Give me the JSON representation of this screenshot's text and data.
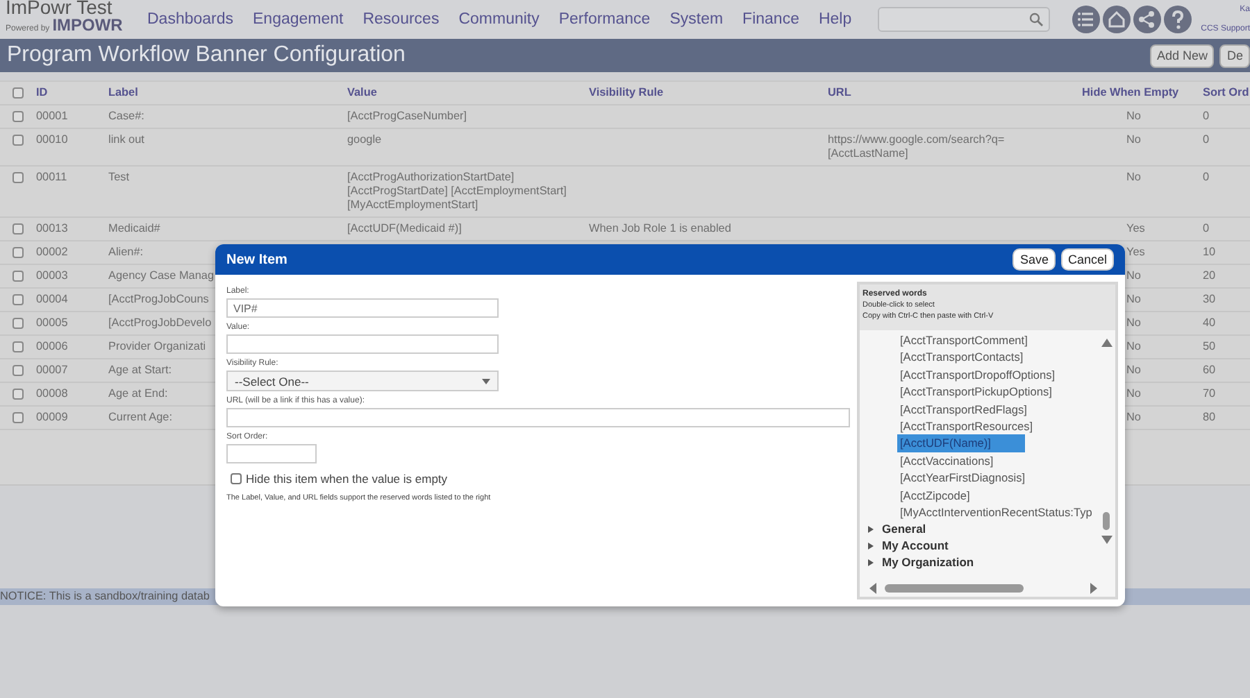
{
  "header": {
    "logo_title": "ImPowr Test",
    "logo_tagline": "Powered by",
    "logo_brand": "IMPOWR",
    "nav": [
      "Dashboards",
      "Engagement",
      "Resources",
      "Community",
      "Performance",
      "System",
      "Finance",
      "Help"
    ],
    "user_name": "Ka",
    "user_org": "CCS Support"
  },
  "page_title": "Program Workflow Banner Configuration",
  "toolbar_buttons": [
    "Add New",
    "De"
  ],
  "table": {
    "all_checked": false,
    "columns": [
      "ID",
      "Label",
      "Value",
      "Visibility Rule",
      "URL",
      "Hide When Empty",
      "Sort Ord"
    ],
    "rows": [
      {
        "checked": false,
        "cells": [
          "00001",
          "Case#:",
          "[AcctProgCaseNumber]",
          "",
          "",
          "No",
          "0"
        ]
      },
      {
        "checked": false,
        "cells": [
          "00010",
          "link out",
          "google",
          "",
          "https://www.google.com/search?q=\n[AcctLastName]",
          "No",
          "0"
        ]
      },
      {
        "checked": false,
        "cells": [
          "00011",
          "Test",
          "[AcctProgAuthorizationStartDate]\n[AcctProgStartDate] [AcctEmploymentStart]\n[MyAcctEmploymentStart]",
          "",
          "",
          "No",
          "0"
        ]
      },
      {
        "checked": false,
        "cells": [
          "00013",
          "Medicaid#",
          "[AcctUDF(Medicaid #)]",
          "When Job Role 1 is enabled",
          "",
          "Yes",
          "0"
        ]
      },
      {
        "checked": false,
        "cells": [
          "00002",
          "Alien#:",
          "",
          "",
          "",
          "Yes",
          "10"
        ]
      },
      {
        "checked": false,
        "cells": [
          "00003",
          "Agency Case Manag",
          "",
          "",
          "",
          "No",
          "20"
        ]
      },
      {
        "checked": false,
        "cells": [
          "00004",
          "[AcctProgJobCouns",
          "",
          "",
          "",
          "No",
          "30"
        ]
      },
      {
        "checked": false,
        "cells": [
          "00005",
          "[AcctProgJobDevelo",
          "",
          "",
          "",
          "No",
          "40"
        ]
      },
      {
        "checked": false,
        "cells": [
          "00006",
          "Provider Organizati",
          "",
          "",
          "",
          "No",
          "50"
        ]
      },
      {
        "checked": false,
        "cells": [
          "00007",
          "Age at Start:",
          "",
          "",
          "",
          "No",
          "60"
        ]
      },
      {
        "checked": false,
        "cells": [
          "00008",
          "Age at End:",
          "",
          "",
          "",
          "No",
          "70"
        ]
      },
      {
        "checked": false,
        "cells": [
          "00009",
          "Current Age:",
          "",
          "",
          "",
          "No",
          "80"
        ]
      }
    ]
  },
  "notice": "NOTICE: This is a sandbox/training datab",
  "dialog": {
    "title": "New Item",
    "buttons": [
      "Save",
      "Cancel"
    ],
    "fields": [
      {
        "kind": "text",
        "label": "Label:",
        "value": "VIP#"
      },
      {
        "kind": "text",
        "label": "Value:"
      },
      {
        "kind": "select",
        "label": "Visibility Rule:",
        "value": "--Select One--"
      },
      {
        "kind": "text",
        "label": "URL (will be a link if this has a value):"
      },
      {
        "kind": "text",
        "label": "Sort Order:"
      },
      {
        "kind": "checkbox",
        "label": "Hide this item when the value is empty",
        "checked": false
      }
    ],
    "note": "The Label, Value, and URL fields support the reserved words listed to the right",
    "reserved": {
      "title": "Reserved words",
      "hints": [
        "Double-click to select",
        "Copy with Ctrl-C then paste with Ctrl-V"
      ],
      "items": [
        {
          "text": "[AcctTransportComment]",
          "selected": false
        },
        {
          "text": "[AcctTransportContacts]",
          "selected": false
        },
        {
          "text": "[AcctTransportDropoffOptions]",
          "selected": false
        },
        {
          "text": "[AcctTransportPickupOptions]",
          "selected": false
        },
        {
          "text": "[AcctTransportRedFlags]",
          "selected": false
        },
        {
          "text": "[AcctTransportResources]",
          "selected": false
        },
        {
          "text": "[AcctUDF(Name)]",
          "selected": true
        },
        {
          "text": "[AcctVaccinations]",
          "selected": false
        },
        {
          "text": "[AcctYearFirstDiagnosis]",
          "selected": false
        },
        {
          "text": "[AcctZipcode]",
          "selected": false
        },
        {
          "text": "[MyAcctInterventionRecentStatus:Typ",
          "selected": false
        }
      ],
      "groups": [
        {
          "label": "General",
          "expanded": false
        },
        {
          "label": "My Account",
          "expanded": false
        },
        {
          "label": "My Organization",
          "expanded": false
        }
      ]
    }
  }
}
